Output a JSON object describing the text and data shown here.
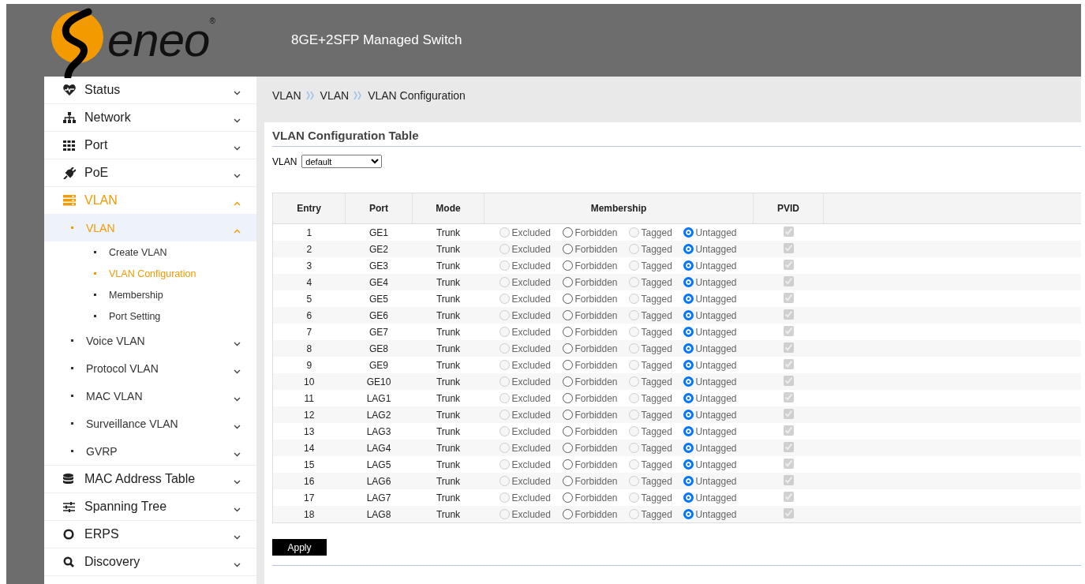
{
  "header": {
    "logo_text": "eneo",
    "trademark": "®",
    "title": "8GE+2SFP Managed Switch"
  },
  "sidebar": {
    "items": [
      {
        "label": "Status",
        "expanded": false,
        "selected": false
      },
      {
        "label": "Network",
        "expanded": false,
        "selected": false
      },
      {
        "label": "Port",
        "expanded": false,
        "selected": false
      },
      {
        "label": "PoE",
        "expanded": false,
        "selected": false
      },
      {
        "label": "VLAN",
        "expanded": true,
        "selected": true,
        "children": [
          {
            "label": "VLAN",
            "expanded": true,
            "selected": true,
            "children": [
              {
                "label": "Create VLAN",
                "selected": false
              },
              {
                "label": "VLAN Configuration",
                "selected": true
              },
              {
                "label": "Membership",
                "selected": false
              },
              {
                "label": "Port Setting",
                "selected": false
              }
            ]
          },
          {
            "label": "Voice VLAN",
            "expanded": false,
            "selected": false
          },
          {
            "label": "Protocol VLAN",
            "expanded": false,
            "selected": false
          },
          {
            "label": "MAC VLAN",
            "expanded": false,
            "selected": false
          },
          {
            "label": "Surveillance VLAN",
            "expanded": false,
            "selected": false
          },
          {
            "label": "GVRP",
            "expanded": false,
            "selected": false
          }
        ]
      },
      {
        "label": "MAC Address Table",
        "expanded": false,
        "selected": false
      },
      {
        "label": "Spanning Tree",
        "expanded": false,
        "selected": false
      },
      {
        "label": "ERPS",
        "expanded": false,
        "selected": false
      },
      {
        "label": "Discovery",
        "expanded": false,
        "selected": false
      }
    ]
  },
  "breadcrumb": [
    "VLAN",
    "VLAN",
    "VLAN Configuration"
  ],
  "panel": {
    "title": "VLAN Configuration Table",
    "vlan_label": "VLAN",
    "vlan_value": "default"
  },
  "table": {
    "columns": [
      "Entry",
      "Port",
      "Mode",
      "Membership",
      "PVID"
    ],
    "rows": [
      {
        "entry": "1",
        "port": "GE1",
        "mode": "Trunk",
        "membership": [
          {
            "label": "Excluded",
            "selected": false,
            "disabled": true
          },
          {
            "label": "Forbidden",
            "selected": false,
            "disabled": false
          },
          {
            "label": "Tagged",
            "selected": false,
            "disabled": true
          },
          {
            "label": "Untagged",
            "selected": true,
            "disabled": false
          }
        ],
        "pvid": true
      },
      {
        "entry": "2",
        "port": "GE2",
        "mode": "Trunk",
        "membership": [
          {
            "label": "Excluded",
            "selected": false,
            "disabled": true
          },
          {
            "label": "Forbidden",
            "selected": false,
            "disabled": false
          },
          {
            "label": "Tagged",
            "selected": false,
            "disabled": true
          },
          {
            "label": "Untagged",
            "selected": true,
            "disabled": false
          }
        ],
        "pvid": true
      },
      {
        "entry": "3",
        "port": "GE3",
        "mode": "Trunk",
        "membership": [
          {
            "label": "Excluded",
            "selected": false,
            "disabled": true
          },
          {
            "label": "Forbidden",
            "selected": false,
            "disabled": false
          },
          {
            "label": "Tagged",
            "selected": false,
            "disabled": true
          },
          {
            "label": "Untagged",
            "selected": true,
            "disabled": false
          }
        ],
        "pvid": true
      },
      {
        "entry": "4",
        "port": "GE4",
        "mode": "Trunk",
        "membership": [
          {
            "label": "Excluded",
            "selected": false,
            "disabled": true
          },
          {
            "label": "Forbidden",
            "selected": false,
            "disabled": false
          },
          {
            "label": "Tagged",
            "selected": false,
            "disabled": true
          },
          {
            "label": "Untagged",
            "selected": true,
            "disabled": false
          }
        ],
        "pvid": true
      },
      {
        "entry": "5",
        "port": "GE5",
        "mode": "Trunk",
        "membership": [
          {
            "label": "Excluded",
            "selected": false,
            "disabled": true
          },
          {
            "label": "Forbidden",
            "selected": false,
            "disabled": false
          },
          {
            "label": "Tagged",
            "selected": false,
            "disabled": true
          },
          {
            "label": "Untagged",
            "selected": true,
            "disabled": false
          }
        ],
        "pvid": true
      },
      {
        "entry": "6",
        "port": "GE6",
        "mode": "Trunk",
        "membership": [
          {
            "label": "Excluded",
            "selected": false,
            "disabled": true
          },
          {
            "label": "Forbidden",
            "selected": false,
            "disabled": false
          },
          {
            "label": "Tagged",
            "selected": false,
            "disabled": true
          },
          {
            "label": "Untagged",
            "selected": true,
            "disabled": false
          }
        ],
        "pvid": true
      },
      {
        "entry": "7",
        "port": "GE7",
        "mode": "Trunk",
        "membership": [
          {
            "label": "Excluded",
            "selected": false,
            "disabled": true
          },
          {
            "label": "Forbidden",
            "selected": false,
            "disabled": false
          },
          {
            "label": "Tagged",
            "selected": false,
            "disabled": true
          },
          {
            "label": "Untagged",
            "selected": true,
            "disabled": false
          }
        ],
        "pvid": true
      },
      {
        "entry": "8",
        "port": "GE8",
        "mode": "Trunk",
        "membership": [
          {
            "label": "Excluded",
            "selected": false,
            "disabled": true
          },
          {
            "label": "Forbidden",
            "selected": false,
            "disabled": false
          },
          {
            "label": "Tagged",
            "selected": false,
            "disabled": true
          },
          {
            "label": "Untagged",
            "selected": true,
            "disabled": false
          }
        ],
        "pvid": true
      },
      {
        "entry": "9",
        "port": "GE9",
        "mode": "Trunk",
        "membership": [
          {
            "label": "Excluded",
            "selected": false,
            "disabled": true
          },
          {
            "label": "Forbidden",
            "selected": false,
            "disabled": false
          },
          {
            "label": "Tagged",
            "selected": false,
            "disabled": true
          },
          {
            "label": "Untagged",
            "selected": true,
            "disabled": false
          }
        ],
        "pvid": true
      },
      {
        "entry": "10",
        "port": "GE10",
        "mode": "Trunk",
        "membership": [
          {
            "label": "Excluded",
            "selected": false,
            "disabled": true
          },
          {
            "label": "Forbidden",
            "selected": false,
            "disabled": false
          },
          {
            "label": "Tagged",
            "selected": false,
            "disabled": true
          },
          {
            "label": "Untagged",
            "selected": true,
            "disabled": false
          }
        ],
        "pvid": true
      },
      {
        "entry": "11",
        "port": "LAG1",
        "mode": "Trunk",
        "membership": [
          {
            "label": "Excluded",
            "selected": false,
            "disabled": true
          },
          {
            "label": "Forbidden",
            "selected": false,
            "disabled": false
          },
          {
            "label": "Tagged",
            "selected": false,
            "disabled": true
          },
          {
            "label": "Untagged",
            "selected": true,
            "disabled": false
          }
        ],
        "pvid": true
      },
      {
        "entry": "12",
        "port": "LAG2",
        "mode": "Trunk",
        "membership": [
          {
            "label": "Excluded",
            "selected": false,
            "disabled": true
          },
          {
            "label": "Forbidden",
            "selected": false,
            "disabled": false
          },
          {
            "label": "Tagged",
            "selected": false,
            "disabled": true
          },
          {
            "label": "Untagged",
            "selected": true,
            "disabled": false
          }
        ],
        "pvid": true
      },
      {
        "entry": "13",
        "port": "LAG3",
        "mode": "Trunk",
        "membership": [
          {
            "label": "Excluded",
            "selected": false,
            "disabled": true
          },
          {
            "label": "Forbidden",
            "selected": false,
            "disabled": false
          },
          {
            "label": "Tagged",
            "selected": false,
            "disabled": true
          },
          {
            "label": "Untagged",
            "selected": true,
            "disabled": false
          }
        ],
        "pvid": true
      },
      {
        "entry": "14",
        "port": "LAG4",
        "mode": "Trunk",
        "membership": [
          {
            "label": "Excluded",
            "selected": false,
            "disabled": true
          },
          {
            "label": "Forbidden",
            "selected": false,
            "disabled": false
          },
          {
            "label": "Tagged",
            "selected": false,
            "disabled": true
          },
          {
            "label": "Untagged",
            "selected": true,
            "disabled": false
          }
        ],
        "pvid": true
      },
      {
        "entry": "15",
        "port": "LAG5",
        "mode": "Trunk",
        "membership": [
          {
            "label": "Excluded",
            "selected": false,
            "disabled": true
          },
          {
            "label": "Forbidden",
            "selected": false,
            "disabled": false
          },
          {
            "label": "Tagged",
            "selected": false,
            "disabled": true
          },
          {
            "label": "Untagged",
            "selected": true,
            "disabled": false
          }
        ],
        "pvid": true
      },
      {
        "entry": "16",
        "port": "LAG6",
        "mode": "Trunk",
        "membership": [
          {
            "label": "Excluded",
            "selected": false,
            "disabled": true
          },
          {
            "label": "Forbidden",
            "selected": false,
            "disabled": false
          },
          {
            "label": "Tagged",
            "selected": false,
            "disabled": true
          },
          {
            "label": "Untagged",
            "selected": true,
            "disabled": false
          }
        ],
        "pvid": true
      },
      {
        "entry": "17",
        "port": "LAG7",
        "mode": "Trunk",
        "membership": [
          {
            "label": "Excluded",
            "selected": false,
            "disabled": true
          },
          {
            "label": "Forbidden",
            "selected": false,
            "disabled": false
          },
          {
            "label": "Tagged",
            "selected": false,
            "disabled": true
          },
          {
            "label": "Untagged",
            "selected": true,
            "disabled": false
          }
        ],
        "pvid": true
      },
      {
        "entry": "18",
        "port": "LAG8",
        "mode": "Trunk",
        "membership": [
          {
            "label": "Excluded",
            "selected": false,
            "disabled": true
          },
          {
            "label": "Forbidden",
            "selected": false,
            "disabled": false
          },
          {
            "label": "Tagged",
            "selected": false,
            "disabled": true
          },
          {
            "label": "Untagged",
            "selected": true,
            "disabled": false
          }
        ],
        "pvid": true
      }
    ]
  },
  "apply_button": "Apply"
}
